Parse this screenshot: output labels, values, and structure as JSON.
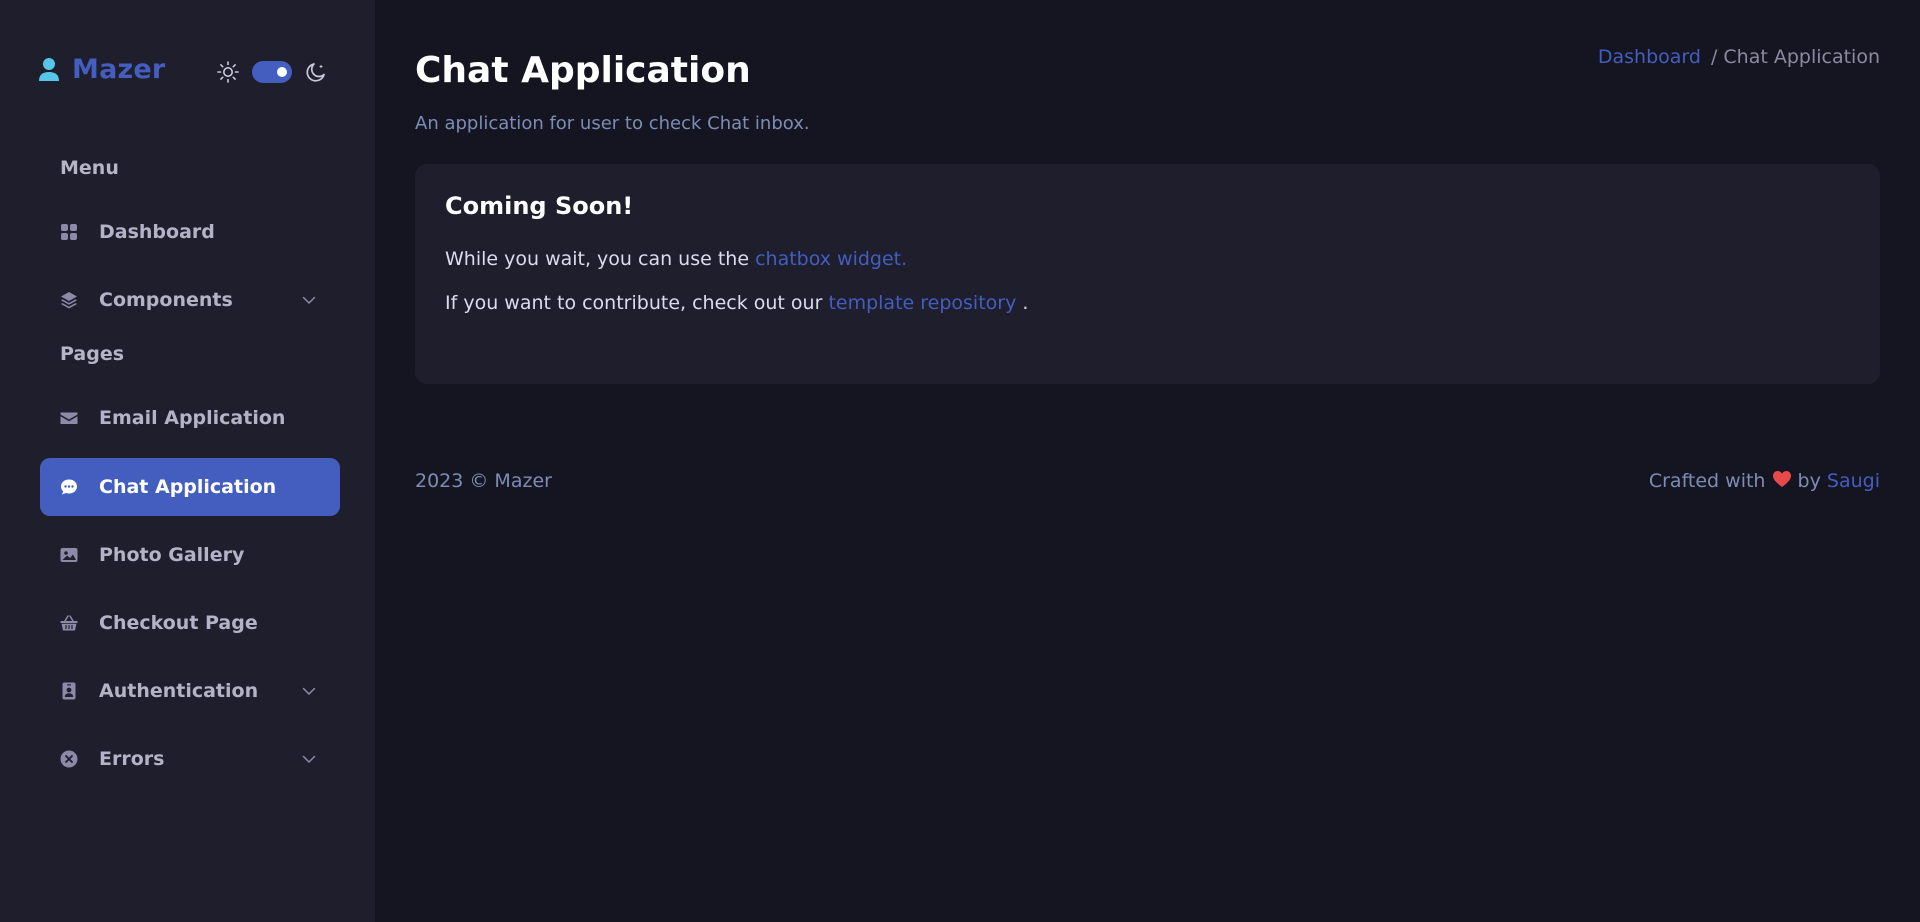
{
  "brand": {
    "name": "Mazer"
  },
  "sidebar": {
    "sections": [
      {
        "title": "Menu"
      },
      {
        "title": "Pages"
      }
    ],
    "items": [
      {
        "label": "Dashboard",
        "icon": "grid-icon"
      },
      {
        "label": "Components",
        "icon": "stack-icon",
        "has_submenu": true
      },
      {
        "label": "Email Application",
        "icon": "envelope-icon"
      },
      {
        "label": "Chat Application",
        "icon": "chat-dots-icon",
        "active": true
      },
      {
        "label": "Photo Gallery",
        "icon": "image-icon"
      },
      {
        "label": "Checkout Page",
        "icon": "basket-icon"
      },
      {
        "label": "Authentication",
        "icon": "person-badge-icon",
        "has_submenu": true
      },
      {
        "label": "Errors",
        "icon": "x-circle-icon",
        "has_submenu": true
      }
    ]
  },
  "header": {
    "title": "Chat Application",
    "subtitle": "An application for user to check Chat inbox."
  },
  "breadcrumb": {
    "items": [
      {
        "label": "Dashboard"
      },
      {
        "label": "/ Chat Application"
      }
    ]
  },
  "card": {
    "title": "Coming Soon!",
    "line1": {
      "text": "While you wait, you can use the ",
      "link": "chatbox widget."
    },
    "line2": {
      "text": "If you want to contribute, check out our ",
      "link": "template repository",
      "suffix": " ."
    }
  },
  "footer": {
    "copyright": "2023 © Mazer",
    "crafted_prefix": "Crafted with ",
    "crafted_by": " by ",
    "author": "Saugi"
  },
  "colors": {
    "accent": "#435ebe",
    "background": "#151521",
    "sidebar": "#1e1e2d",
    "heart": "#e84a4a"
  }
}
